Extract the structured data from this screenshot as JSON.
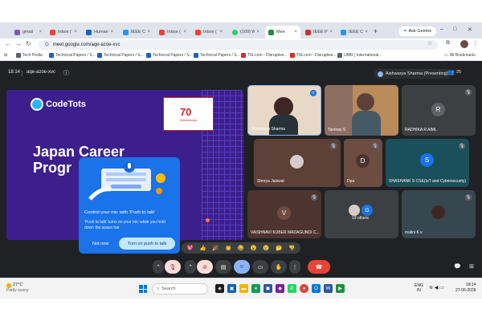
{
  "browser": {
    "tabs": [
      {
        "label": "gmail",
        "color": "#7e57c2"
      },
      {
        "label": "Inbox (",
        "color": "#ea4335"
      },
      {
        "label": "Human",
        "color": "#1565c0"
      },
      {
        "label": "IEEE Co",
        "color": "#2196f3"
      },
      {
        "label": "Inbox (",
        "color": "#ea4335"
      },
      {
        "label": "Inbox (",
        "color": "#ea4335"
      },
      {
        "label": "(109) W",
        "color": "#25d366"
      },
      {
        "label": "Mee",
        "color": "#1e8e3e",
        "active": true
      },
      {
        "label": "IEEE Pu",
        "color": "#d32f2f"
      },
      {
        "label": "IEEE Co",
        "color": "#2196f3"
      }
    ],
    "ask_gemini": "Ask Gemini",
    "url": "meet.google.com/aqe-azoe-xvc",
    "bookmarks": [
      {
        "label": "Tech Pedia",
        "color": "#5f6368"
      },
      {
        "label": "Technical Papers / S...",
        "color": "#1565c0"
      },
      {
        "label": "Technical Papers / S...",
        "color": "#1565c0"
      },
      {
        "label": "Technical Papers / S...",
        "color": "#1565c0"
      },
      {
        "label": "Technical Papers / S...",
        "color": "#1565c0"
      },
      {
        "label": "TIE.com - Disruptive...",
        "color": "#d32f2f"
      },
      {
        "label": "TIE.com - Disruptive...",
        "color": "#d32f2f"
      },
      {
        "label": "IJMR | International...",
        "color": "#5f6368"
      }
    ],
    "all_bookmarks": "All Bookmarks"
  },
  "meet": {
    "time": "18:14",
    "code": "aqe-azoe-xvc",
    "presenter": "Aishwarya Sharma (Presenting)",
    "people_count": "25",
    "slide": {
      "brand": "CodeTots",
      "title_line1": "Japan Career",
      "title_line2": "Progr",
      "anniversary_number": "70",
      "anniversary_text": "Anniversary"
    },
    "popup": {
      "title": "Control your mic with 'Push to talk'",
      "desc": "'Push to talk' turns on your mic while you hold down the space bar",
      "not_now": "Not now",
      "turn_on": "Turn on push to talk"
    },
    "tiles": [
      {
        "name": "Aishwarya Sharma"
      },
      {
        "name": "Tanmay S"
      },
      {
        "name": "RADHIKA R AIML",
        "initial": "R"
      },
      {
        "name": "Shreya Jaiswal"
      },
      {
        "name": "Dpa",
        "initial": "D"
      },
      {
        "name": "SHASHANK S CSE(IoT and Cybersecurity)",
        "initial": "S"
      },
      {
        "name": "VAISHNAVI KUBER MADAGUNDI C...",
        "initial": "V"
      },
      {
        "name": "19 others",
        "initial": "G"
      },
      {
        "name": "malini K v"
      }
    ],
    "reactions": [
      "💖",
      "👍",
      "🎉",
      "👏",
      "😂",
      "😮",
      "😢",
      "🤔",
      "👎"
    ]
  },
  "taskbar": {
    "temp": "27°C",
    "condition": "Partly sunny",
    "search": "Search",
    "lang": "ENG",
    "region": "IN",
    "time": "18:14",
    "date": "27-06-2026"
  }
}
